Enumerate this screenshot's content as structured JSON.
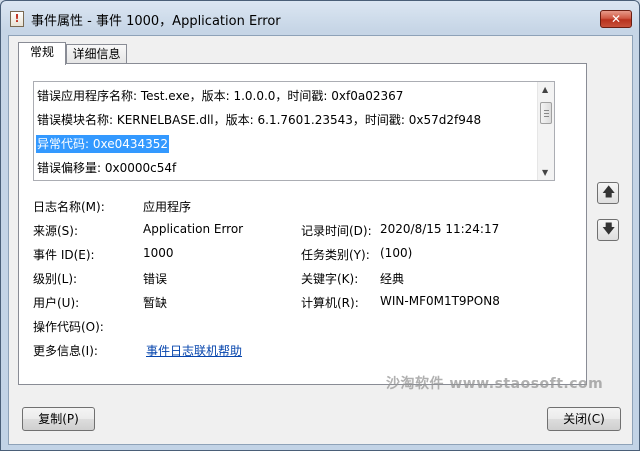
{
  "window": {
    "title": "事件属性 - 事件 1000，Application Error",
    "close_label": "✕"
  },
  "tabs": [
    {
      "label": "常规",
      "active": true
    },
    {
      "label": "详细信息",
      "active": false
    }
  ],
  "description": {
    "lines": [
      "错误应用程序名称: Test.exe，版本: 1.0.0.0，时间戳: 0xf0a02367",
      "错误模块名称: KERNELBASE.dll，版本: 6.1.7601.23543，时间戳: 0x57d2f948",
      "异常代码: 0xe0434352",
      "错误偏移量: 0x0000c54f"
    ],
    "selected_index": 2
  },
  "fields": {
    "log_name_label": "日志名称(M):",
    "log_name_value": "应用程序",
    "source_label": "来源(S):",
    "source_value": "Application Error",
    "logged_label": "记录时间(D):",
    "logged_value": "2020/8/15 11:24:17",
    "event_id_label": "事件 ID(E):",
    "event_id_value": "1000",
    "task_label": "任务类别(Y):",
    "task_value": "(100)",
    "level_label": "级别(L):",
    "level_value": "错误",
    "keywords_label": "关键字(K):",
    "keywords_value": "经典",
    "user_label": "用户(U):",
    "user_value": "暂缺",
    "computer_label": "计算机(R):",
    "computer_value": "WIN-MF0M1T9PON8",
    "opcode_label": "操作代码(O):",
    "more_info_label": "更多信息(I):",
    "more_info_link": "事件日志联机帮助"
  },
  "buttons": {
    "copy": "复制(P)",
    "close": "关闭(C)"
  },
  "watermark": "沙淘软件 www.staosoft.com",
  "colors": {
    "selection": "#3399ff",
    "link": "#0645ad",
    "close_button": "#c8503a"
  }
}
